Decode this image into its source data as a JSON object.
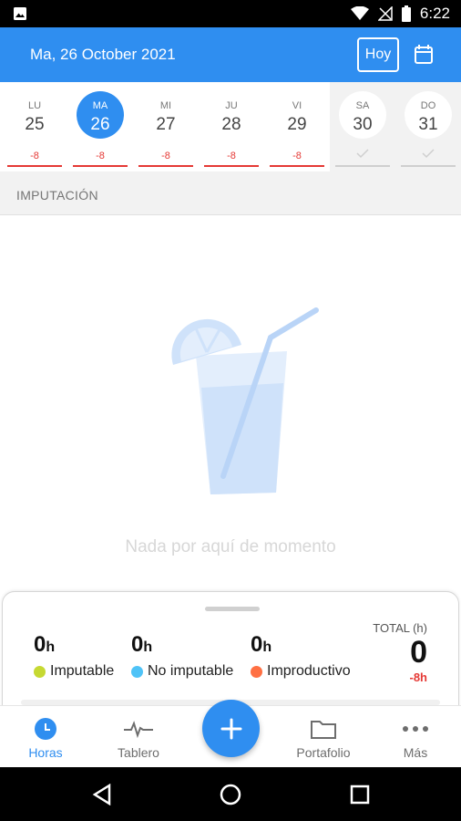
{
  "status_bar": {
    "time": "6:22"
  },
  "header": {
    "date": "Ma, 26 October 2021",
    "today_button": "Hoy"
  },
  "week": {
    "days": [
      {
        "name": "LU",
        "num": "25",
        "hours": "-8"
      },
      {
        "name": "MA",
        "num": "26",
        "hours": "-8"
      },
      {
        "name": "MI",
        "num": "27",
        "hours": "-8"
      },
      {
        "name": "JU",
        "num": "28",
        "hours": "-8"
      },
      {
        "name": "VI",
        "num": "29",
        "hours": "-8"
      },
      {
        "name": "SA",
        "num": "30",
        "hours": ""
      },
      {
        "name": "DO",
        "num": "31",
        "hours": ""
      }
    ]
  },
  "section": {
    "title": "IMPUTACIÓN"
  },
  "empty_state": {
    "text": "Nada por aquí de momento"
  },
  "summary": {
    "metrics": [
      {
        "value": "0",
        "unit": "h",
        "label": "Imputable",
        "color": "#c6d932"
      },
      {
        "value": "0",
        "unit": "h",
        "label": "No imputable",
        "color": "#4fc3f7"
      },
      {
        "value": "0",
        "unit": "h",
        "label": "Improductivo",
        "color": "#ff7043"
      }
    ],
    "total_label": "TOTAL (h)",
    "total_value": "0",
    "total_diff": "-8h"
  },
  "nav": {
    "items": [
      {
        "label": "Horas",
        "icon": "clock-icon"
      },
      {
        "label": "Tablero",
        "icon": "pulse-icon"
      },
      {
        "label": "Portafolio",
        "icon": "folder-icon"
      },
      {
        "label": "Más",
        "icon": "more-icon"
      }
    ]
  },
  "colors": {
    "primary": "#2f8ef0",
    "negative": "#e53935"
  }
}
